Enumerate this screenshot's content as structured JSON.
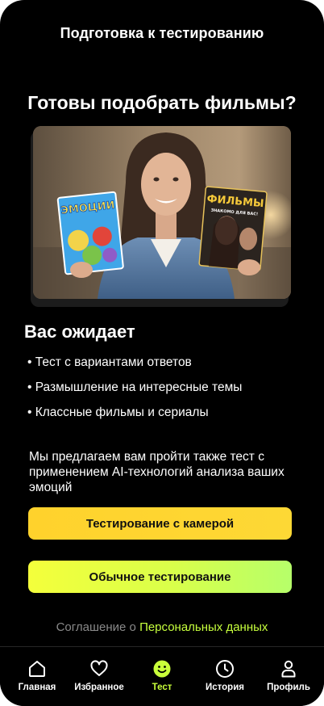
{
  "header": {
    "title": "Подготовка к тестированию"
  },
  "hero": {
    "title": "Готовы подобрать фильмы?",
    "left_card_text": "ЭМОЦИИ",
    "right_card_title": "ФИЛЬМЫ",
    "right_card_subtitle": "ЗНАКОМО ДЛЯ ВАС!"
  },
  "expect": {
    "title": "Вас ожидает",
    "items": [
      "• Тест с вариантами ответов",
      "• Размышление на интересные темы",
      "• Классные фильмы и сериалы"
    ]
  },
  "ai_text": "Мы предлагаем вам пройти также тест с применением AI-технологий анализа ваших эмоций",
  "buttons": {
    "camera": "Тестирование с камерой",
    "regular": "Обычное тестирование"
  },
  "agreement": {
    "prefix": "Соглашение о ",
    "link": "Персональных данных"
  },
  "tabs": [
    {
      "label": "Главная",
      "icon": "home-icon"
    },
    {
      "label": "Избранное",
      "icon": "heart-icon"
    },
    {
      "label": "Тест",
      "icon": "smile-icon",
      "active": true
    },
    {
      "label": "История",
      "icon": "clock-icon"
    },
    {
      "label": "Профиль",
      "icon": "person-icon"
    }
  ],
  "colors": {
    "accent": "#c9ff3a",
    "camera_button": "#ffd22c",
    "regular_button": "#e4ff45"
  }
}
